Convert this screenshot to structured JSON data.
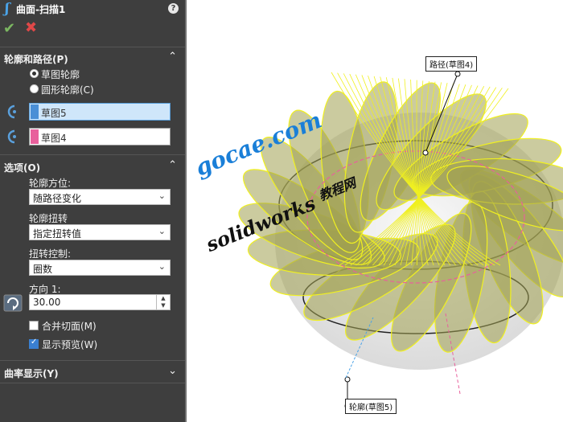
{
  "panel": {
    "title": "曲面-扫描1",
    "help_glyph": "?",
    "ok_glyph": "✔",
    "cancel_glyph": "✖",
    "section_profile": {
      "label": "轮廓和路径(P)",
      "chevron": "⌃",
      "options": [
        {
          "label": "草图轮廓",
          "selected": true
        },
        {
          "label": "圆形轮廓(C)",
          "selected": false
        }
      ],
      "profile_selection": "草图5",
      "path_selection": "草图4",
      "profile_color": "#4a8fd6",
      "path_color": "#e8609c"
    },
    "section_options": {
      "label": "选项(O)",
      "chevron": "⌃",
      "orientation_label": "轮廓方位:",
      "orientation_value": "随路径变化",
      "twist_label": "轮廓扭转",
      "twist_value": "指定扭转值",
      "twist_control_label": "扭转控制:",
      "twist_control_value": "圈数",
      "direction_label": "方向 1:",
      "direction_value": "30.00",
      "merge_tangent_label": "合并切面(M)",
      "merge_tangent_checked": false,
      "show_preview_label": "显示预览(W)",
      "show_preview_checked": true,
      "dropdown_glyph": "⌄"
    },
    "section_curvature": {
      "label": "曲率显示(Y)",
      "chevron": "⌄"
    }
  },
  "viewport": {
    "path_callout": "路径(草图4)",
    "profile_callout": "轮廓(草图5)",
    "watermark_line1": "gocae.com",
    "watermark_line2": "solidworks",
    "watermark_line3": "教程网"
  },
  "colors": {
    "panel_bg": "#3e3e3e",
    "surface_fill": "#a0a050",
    "surface_line": "#f0f020",
    "path_line": "#e8609c",
    "watermark_blue": "#1a7fd8"
  }
}
